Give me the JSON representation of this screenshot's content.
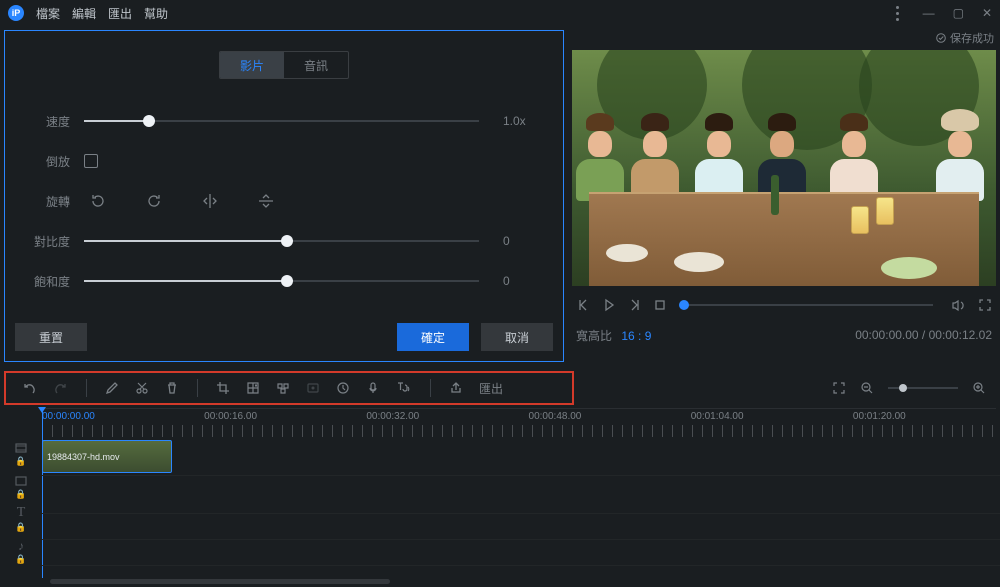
{
  "titlebar": {
    "menu": [
      "檔案",
      "編輯",
      "匯出",
      "幫助"
    ]
  },
  "editPanel": {
    "tabs": {
      "video": "影片",
      "audio": "音訊"
    },
    "speed": {
      "label": "速度",
      "value": "1.0x",
      "pos": 16
    },
    "reverse": {
      "label": "倒放"
    },
    "rotate": {
      "label": "旋轉"
    },
    "contrast": {
      "label": "對比度",
      "value": "0",
      "pos": 50
    },
    "saturation": {
      "label": "飽和度",
      "value": "0",
      "pos": 50
    },
    "buttons": {
      "reset": "重置",
      "ok": "確定",
      "cancel": "取消"
    }
  },
  "preview": {
    "status": "保存成功",
    "ratioLabel": "寬高比",
    "ratioValue": "16 : 9",
    "time": "00:00:00.00 / 00:00:12.02"
  },
  "toolbar": {
    "exportLabel": "匯出"
  },
  "timeline": {
    "current": "00:00:00.00",
    "labels": [
      "00:00:16.00",
      "00:00:32.00",
      "00:00:48.00",
      "00:01:04.00",
      "00:01:20.00"
    ],
    "clipName": "19884307-hd.mov"
  }
}
